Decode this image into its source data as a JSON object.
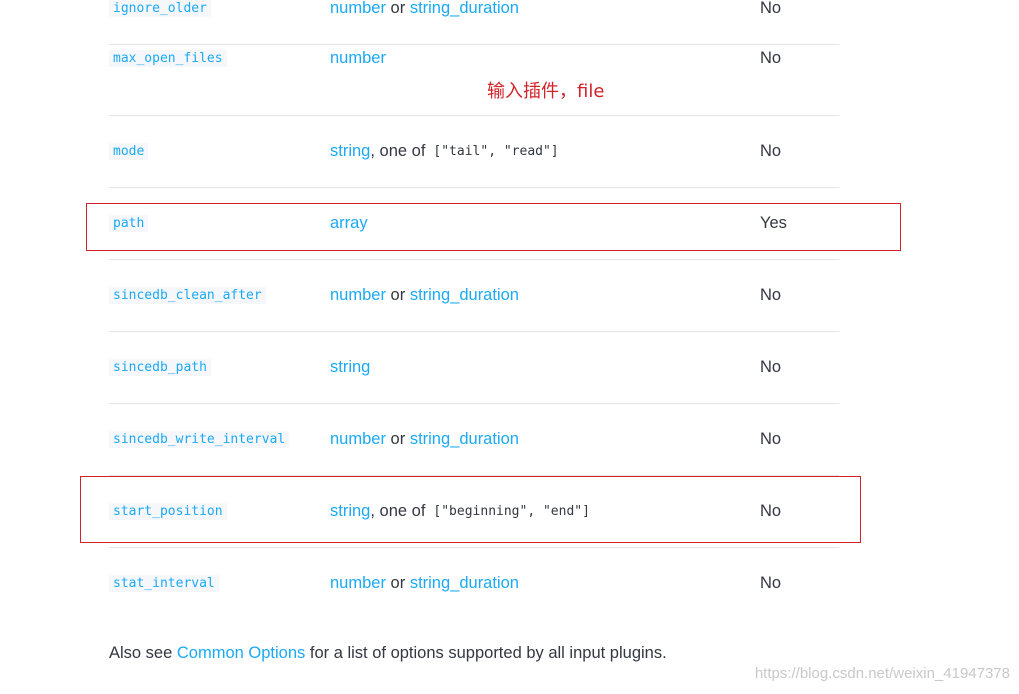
{
  "rows": [
    {
      "setting": "ignore_older",
      "type1": "number",
      "sep": "or",
      "type2": "string_duration",
      "required": "No"
    },
    {
      "setting": "max_open_files",
      "type1": "number",
      "required": "No"
    },
    {
      "setting": "mode",
      "type1": "string",
      "sep": ", one of",
      "code": "[\"tail\", \"read\"]",
      "required": "No"
    },
    {
      "setting": "path",
      "type1": "array",
      "required": "Yes"
    },
    {
      "setting": "sincedb_clean_after",
      "type1": "number",
      "sep": "or",
      "type2": "string_duration",
      "required": "No"
    },
    {
      "setting": "sincedb_path",
      "type1": "string",
      "required": "No"
    },
    {
      "setting": "sincedb_write_interval",
      "type1": "number",
      "sep": "or",
      "type2": "string_duration",
      "required": "No"
    },
    {
      "setting": "start_position",
      "type1": "string",
      "sep": ", one of",
      "code": "[\"beginning\", \"end\"]",
      "required": "No"
    },
    {
      "setting": "stat_interval",
      "type1": "number",
      "sep": "or",
      "type2": "string_duration",
      "required": "No"
    }
  ],
  "annotation": {
    "text": "输入插件，file",
    "color": "#d1232a"
  },
  "footer": {
    "prefix": "Also see",
    "link": "Common Options",
    "suffix": "for a list of options supported by all input plugins."
  },
  "watermark": "https://blog.csdn.net/weixin_41947378",
  "colors": {
    "link": "#1ba9f5",
    "text": "#343741",
    "highlight": "#d1232a"
  }
}
